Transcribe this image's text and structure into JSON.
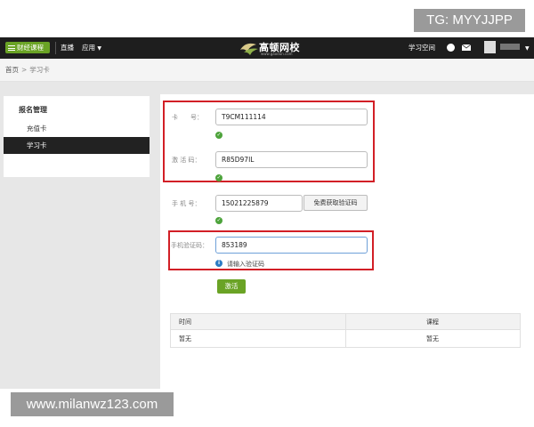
{
  "watermark": {
    "top": "TG: MYYJJPP",
    "bottom": "www.milanwz123.com"
  },
  "topbar": {
    "brand_button": "财经课程",
    "nav": [
      "直播",
      "应用"
    ],
    "logo_text": "高顿网校",
    "logo_sub": "www.gaodun.com",
    "study_space": "学习空间"
  },
  "breadcrumb": {
    "home": "首页",
    "separator": ">",
    "current": "学习卡"
  },
  "sidebar": {
    "title": "报名管理",
    "items": [
      {
        "label": "充值卡",
        "active": false
      },
      {
        "label": "学习卡",
        "active": true
      }
    ]
  },
  "form": {
    "card_no": {
      "label": "卡　　号：",
      "value": "T9CM111114"
    },
    "activation_code": {
      "label": "激 活 码：",
      "value": "R85D97IL"
    },
    "phone": {
      "label": "手 机 号：",
      "value": "15021225879",
      "button": "免费获取验证码"
    },
    "sms_code": {
      "label": "手机验证码：",
      "value": "853189",
      "hint": "请输入验证码"
    },
    "submit": "激活"
  },
  "table": {
    "headers": [
      "时间",
      "课程"
    ],
    "rows": [
      [
        "暂无",
        "暂无"
      ]
    ]
  },
  "colors": {
    "accent_green": "#6aa325",
    "highlight_red": "#d21f26",
    "topbar": "#1e1e1e",
    "info_blue": "#2c7cc4"
  }
}
